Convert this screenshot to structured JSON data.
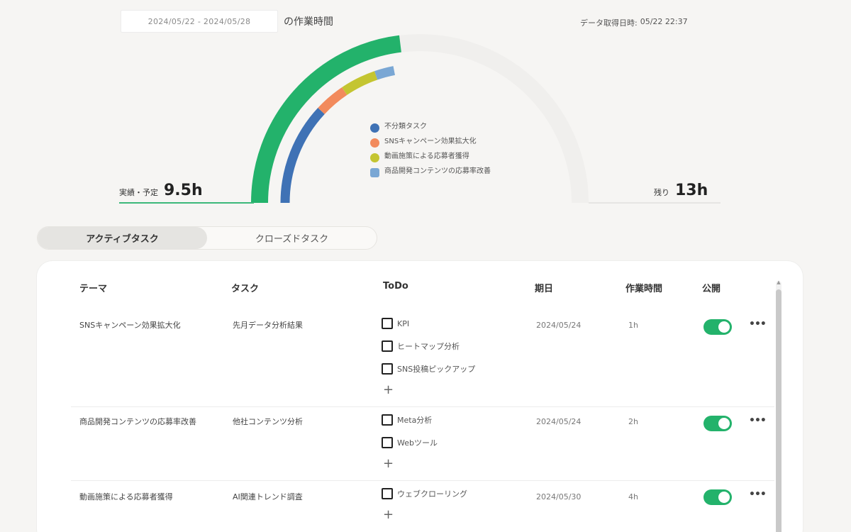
{
  "header": {
    "date_range": "2024/05/22 - 2024/05/28",
    "date_suffix": "の作業時間",
    "fetched_label": "データ取得日時:",
    "fetched_value": "05/22 22:37"
  },
  "gauge": {
    "done_label": "実績・予定",
    "done_value": "9.5h",
    "remain_label": "残り",
    "remain_value": "13h",
    "colors": {
      "done": "#23b26b",
      "track": "#f0efed",
      "uncategorized": "#3f72b5",
      "sns": "#f28a5c",
      "recruit": "#c4c531",
      "ad": "#7aa7d4"
    },
    "legend": [
      {
        "label": "不分類タスク",
        "color": "#3f72b5",
        "shape": "circle",
        "icon": "dot-icon"
      },
      {
        "label": "SNSキャンペーン効果拡大化",
        "color": "#f28a5c",
        "shape": "circle",
        "icon": "dot-icon"
      },
      {
        "label": "動画施策による応募者獲得",
        "color": "#c4c531",
        "shape": "circle",
        "icon": "dot-icon"
      },
      {
        "label": "商品開発コンテンツの応募率改善",
        "color": "#7aa7d4",
        "shape": "square",
        "icon": "square-dot-icon"
      }
    ]
  },
  "tabs": [
    {
      "label": "アクティブタスク",
      "active": true
    },
    {
      "label": "クローズドタスク",
      "active": false
    }
  ],
  "table": {
    "headers": [
      "テーマ",
      "タスク",
      "ToDo",
      "期日",
      "作業時間",
      "公開"
    ],
    "rows": [
      {
        "theme": "SNSキャンペーン効果拡大化",
        "task": "先月データ分析結果",
        "todos": [
          "KPI",
          "ヒートマップ分析",
          "SNS投稿ピックアップ"
        ],
        "due": "2024/05/24",
        "hours": "1h",
        "public": true
      },
      {
        "theme": "商品開発コンテンツの応募率改善",
        "task": "他社コンテンツ分析",
        "todos": [
          "Meta分析",
          "Webツール"
        ],
        "due": "2024/05/24",
        "hours": "2h",
        "public": true
      },
      {
        "theme": "動画施策による応募者獲得",
        "task": "AI関連トレンド調査",
        "todos": [
          "ウェブクローリング"
        ],
        "due": "2024/05/30",
        "hours": "4h",
        "public": true
      }
    ],
    "add_symbol": "+",
    "more_symbol": "•••"
  }
}
